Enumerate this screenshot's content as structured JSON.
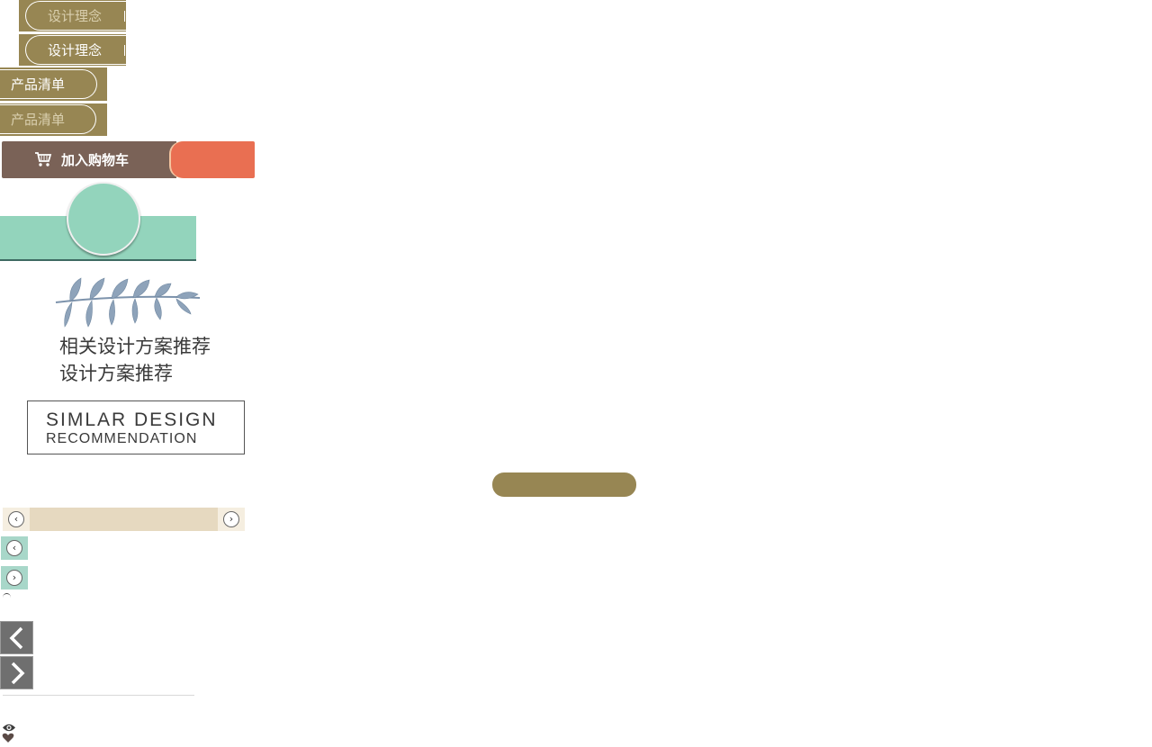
{
  "nav": {
    "design_concept_1": "设计理念",
    "design_concept_2": "设计理念",
    "product_list_1": "产品清单",
    "product_list_2": "产品清单"
  },
  "cart": {
    "label": "加入购物车",
    "icon": "cart-icon"
  },
  "recommend": {
    "title_cn_1": "相关设计方案推荐",
    "title_cn_2": "设计方案推荐",
    "title_en_1": "SIMLAR DESIGN",
    "title_en_2": "RECOMMENDATION"
  },
  "colors": {
    "olive": "#978653",
    "cart_brown": "#7a6257",
    "cart_orange": "#e96f52",
    "mint": "#93d4bc",
    "beige": "#e6d9c0"
  },
  "icons": [
    "leaf-icon",
    "chevron-left-icon",
    "chevron-right-icon",
    "eye-icon",
    "heart-icon"
  ]
}
